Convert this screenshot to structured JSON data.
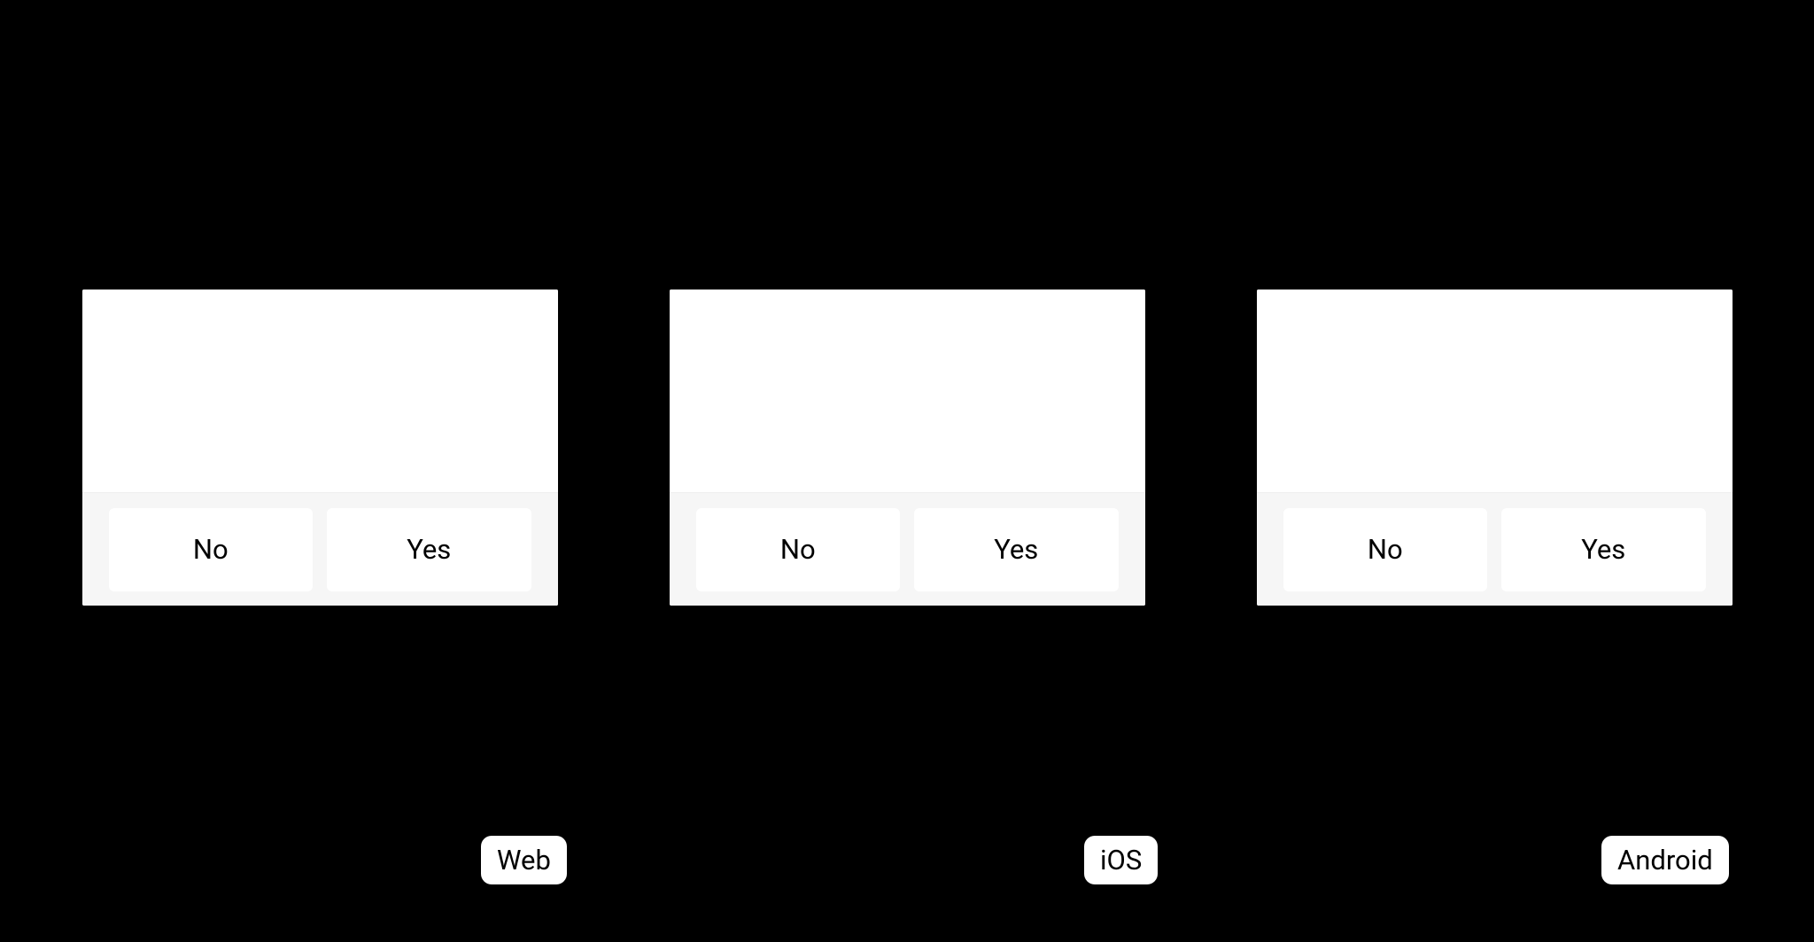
{
  "panels": [
    {
      "platform": "Web",
      "buttons": {
        "no": "No",
        "yes": "Yes"
      }
    },
    {
      "platform": "iOS",
      "buttons": {
        "no": "No",
        "yes": "Yes"
      }
    },
    {
      "platform": "Android",
      "buttons": {
        "no": "No",
        "yes": "Yes"
      }
    }
  ]
}
